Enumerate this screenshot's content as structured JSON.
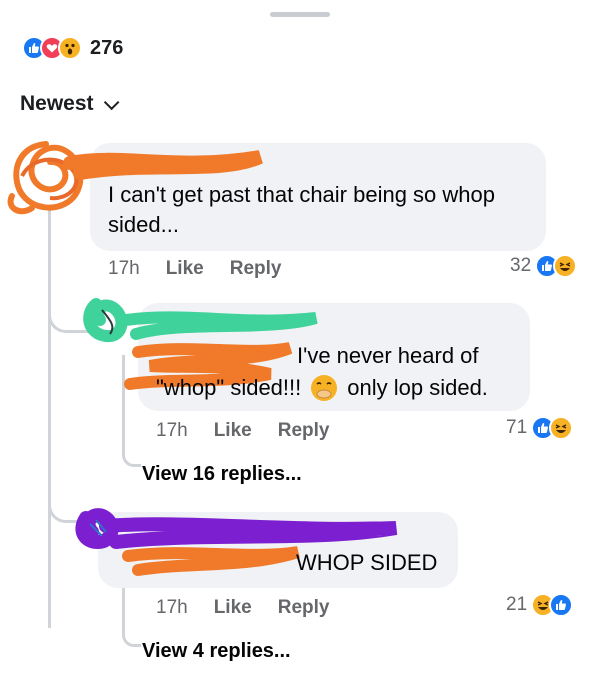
{
  "header": {
    "reaction_count": "276",
    "sort_label": "Newest"
  },
  "comments": [
    {
      "text": "I can't get past that chair being so whop sided...",
      "time": "17h",
      "like_label": "Like",
      "reply_label": "Reply",
      "reaction_count": "32"
    },
    {
      "text_part1": "I've never heard of",
      "text_part2": "\"whop\" sided!!!",
      "text_part3": "only lop sided.",
      "time": "17h",
      "like_label": "Like",
      "reply_label": "Reply",
      "reaction_count": "71",
      "view_replies": "View 16 replies..."
    },
    {
      "text": "WHOP SIDED",
      "time": "17h",
      "like_label": "Like",
      "reply_label": "Reply",
      "reaction_count": "21",
      "view_replies": "View 4 replies..."
    }
  ],
  "colors": {
    "like": "#1877f2",
    "love": "#f33e58",
    "haha": "#f7b125",
    "scribble_orange": "#f07a2a",
    "scribble_green": "#3fd39b",
    "scribble_purple": "#7b1fd0"
  },
  "icons": [
    "like-icon",
    "love-icon",
    "wow-icon",
    "haha-icon",
    "chevron-down-icon"
  ]
}
